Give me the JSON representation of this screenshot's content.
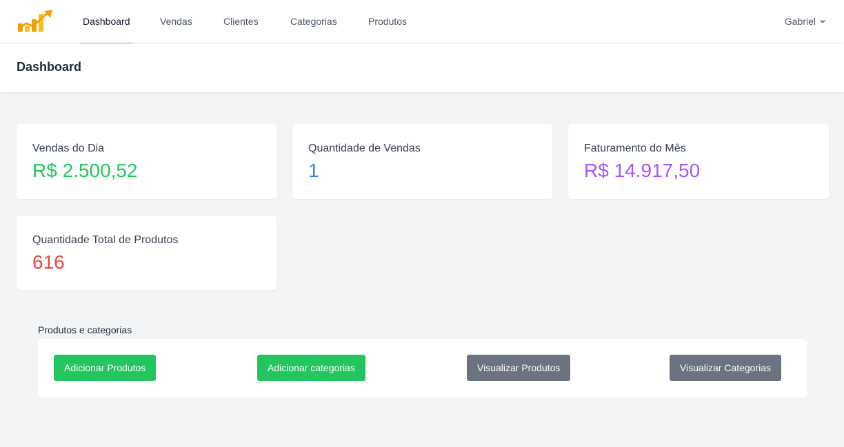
{
  "nav": {
    "items": [
      {
        "label": "Dashboard",
        "active": true
      },
      {
        "label": "Vendas"
      },
      {
        "label": "Clientes"
      },
      {
        "label": "Categorias"
      },
      {
        "label": "Produtos"
      }
    ],
    "user": "Gabriel"
  },
  "header": {
    "title": "Dashboard"
  },
  "cards": [
    {
      "label": "Vendas do Dia",
      "value": "R$ 2.500,52",
      "color": "#22c55e"
    },
    {
      "label": "Quantidade de Vendas",
      "value": "1",
      "color": "#3b82f6"
    },
    {
      "label": "Faturamento do Mês",
      "value": "R$ 14.917,50",
      "color": "#a855f7"
    },
    {
      "label": "Quantidade Total de Produtos",
      "value": "616",
      "color": "#ef4444"
    }
  ],
  "actions": {
    "title": "Produtos e categorias",
    "buttons": [
      {
        "label": "Adicionar Produtos",
        "color": "#22c55e"
      },
      {
        "label": "Adicionar categorias",
        "color": "#22c55e"
      },
      {
        "label": "Visualizar Produtos",
        "color": "#6b7280"
      },
      {
        "label": "Visualizar Categorias",
        "color": "#6b7280"
      }
    ]
  },
  "icons": {
    "logo": "chart-growth-logo",
    "user_menu": "chevron-down-icon"
  }
}
